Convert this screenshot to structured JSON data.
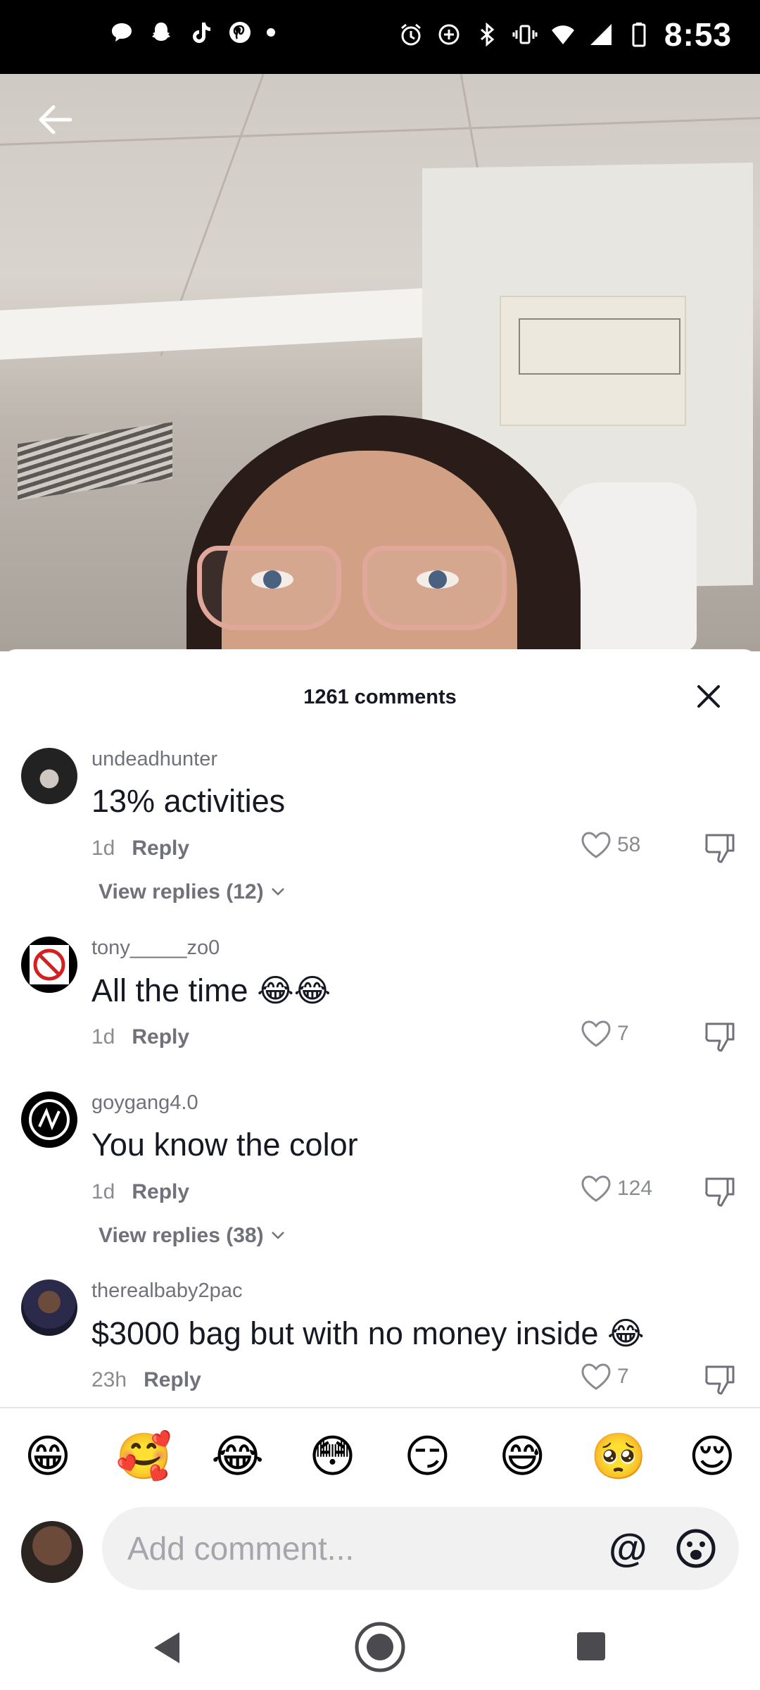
{
  "status_bar": {
    "time": "8:53",
    "left_icons": [
      "message-icon",
      "snapchat-icon",
      "tiktok-icon",
      "pinterest-icon",
      "dot-icon"
    ],
    "right_icons": [
      "alarm-icon",
      "data-saver-icon",
      "bluetooth-icon",
      "vibrate-icon",
      "wifi-icon",
      "signal-icon",
      "battery-icon"
    ]
  },
  "video": {
    "back_icon": "back-arrow-icon"
  },
  "comments_sheet": {
    "title": "1261 comments",
    "close_icon": "close-icon",
    "comments": [
      {
        "username": "undeadhunter",
        "text": "13% activities",
        "age": "1d",
        "reply_label": "Reply",
        "likes": "58",
        "view_replies": "View replies (12)"
      },
      {
        "username": "tony_____zo0",
        "text": "All the time 😂😂",
        "age": "1d",
        "reply_label": "Reply",
        "likes": "7"
      },
      {
        "username": "goygang4.0",
        "text": "You know the color",
        "age": "1d",
        "reply_label": "Reply",
        "likes": "124",
        "view_replies": "View replies (38)"
      },
      {
        "username": "therealbaby2pac",
        "text": "$3000 bag but with no money inside 😂",
        "age": "23h",
        "reply_label": "Reply",
        "likes": "7"
      }
    ]
  },
  "quick_emojis": [
    "😁",
    "🥰",
    "😂",
    "😳",
    "😏",
    "😅",
    "🥺",
    "😌"
  ],
  "composer": {
    "placeholder": "Add comment...",
    "at_label": "@",
    "emoji_icon": "emoji-icon"
  },
  "nav_bar": {
    "icons": [
      "nav-back-icon",
      "nav-home-icon",
      "nav-recents-icon"
    ]
  },
  "colors": {
    "text_primary": "#161823",
    "text_secondary": "#70717a",
    "status_bar_bg": "#000000"
  }
}
